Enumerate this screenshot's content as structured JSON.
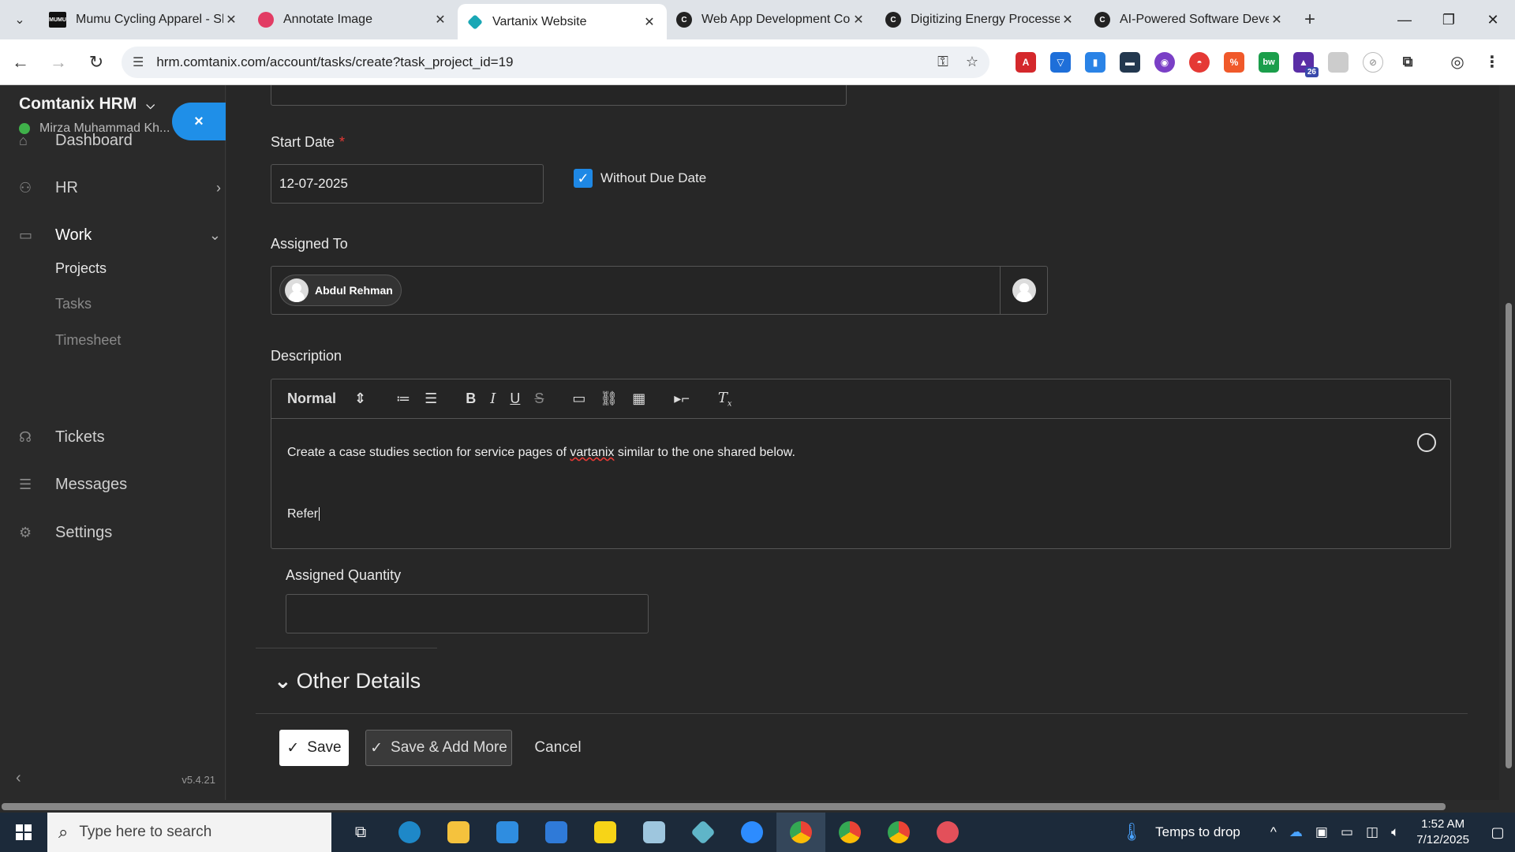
{
  "browser": {
    "tabs": [
      {
        "title": "Mumu Cycling Apparel - Sl",
        "fav_color": "#111111",
        "fav_text": "MUMU"
      },
      {
        "title": "Annotate Image",
        "fav_color": "#e23c64",
        "fav_text": ""
      },
      {
        "title": "Vartanix Website",
        "fav_color": "#1aa7b5",
        "fav_text": ""
      },
      {
        "title": "Web App Development Co",
        "fav_color": "#222222",
        "fav_text": "C"
      },
      {
        "title": "Digitizing Energy Processe",
        "fav_color": "#222222",
        "fav_text": "C"
      },
      {
        "title": "AI-Powered Software Deve",
        "fav_color": "#222222",
        "fav_text": "C"
      }
    ],
    "active_tab": 2,
    "url": "hrm.comtanix.com/account/tasks/create?task_project_id=19",
    "extension_badge": "26"
  },
  "sidebar": {
    "brand": "Comtanix HRM",
    "user": "Mirza Muhammad Kh...",
    "close_label": "×",
    "items": [
      {
        "label": "Dashboard",
        "icon": "home-icon"
      },
      {
        "label": "HR",
        "icon": "people-icon"
      },
      {
        "label": "Work",
        "icon": "briefcase-icon"
      },
      {
        "label": "Tickets",
        "icon": "headset-icon"
      },
      {
        "label": "Messages",
        "icon": "message-icon"
      },
      {
        "label": "Settings",
        "icon": "gear-icon"
      }
    ],
    "work_sub": [
      "Projects",
      "Tasks",
      "Timesheet"
    ],
    "version": "v5.4.21"
  },
  "form": {
    "start_date_label": "Start Date",
    "start_date_required": "*",
    "start_date_value": "12-07-2025",
    "without_due_date_label": "Without Due Date",
    "without_due_date_checked": true,
    "assigned_to_label": "Assigned To",
    "assignee": "Abdul Rehman",
    "description_label": "Description",
    "editor_format": "Normal",
    "description_line1_a": "Create a case studies section for service pages of ",
    "description_line1_b": "vartanix",
    "description_line1_c": " similar to the one shared below.",
    "description_line2": "Refer",
    "assigned_quantity_label": "Assigned Quantity",
    "assigned_quantity_value": "",
    "other_details_label": "Other Details",
    "save_label": "Save",
    "save_more_label": "Save & Add More",
    "cancel_label": "Cancel"
  },
  "taskbar": {
    "search_placeholder": "Type here to search",
    "weather": "Temps to drop",
    "time": "1:52 AM",
    "date": "7/12/2025"
  }
}
